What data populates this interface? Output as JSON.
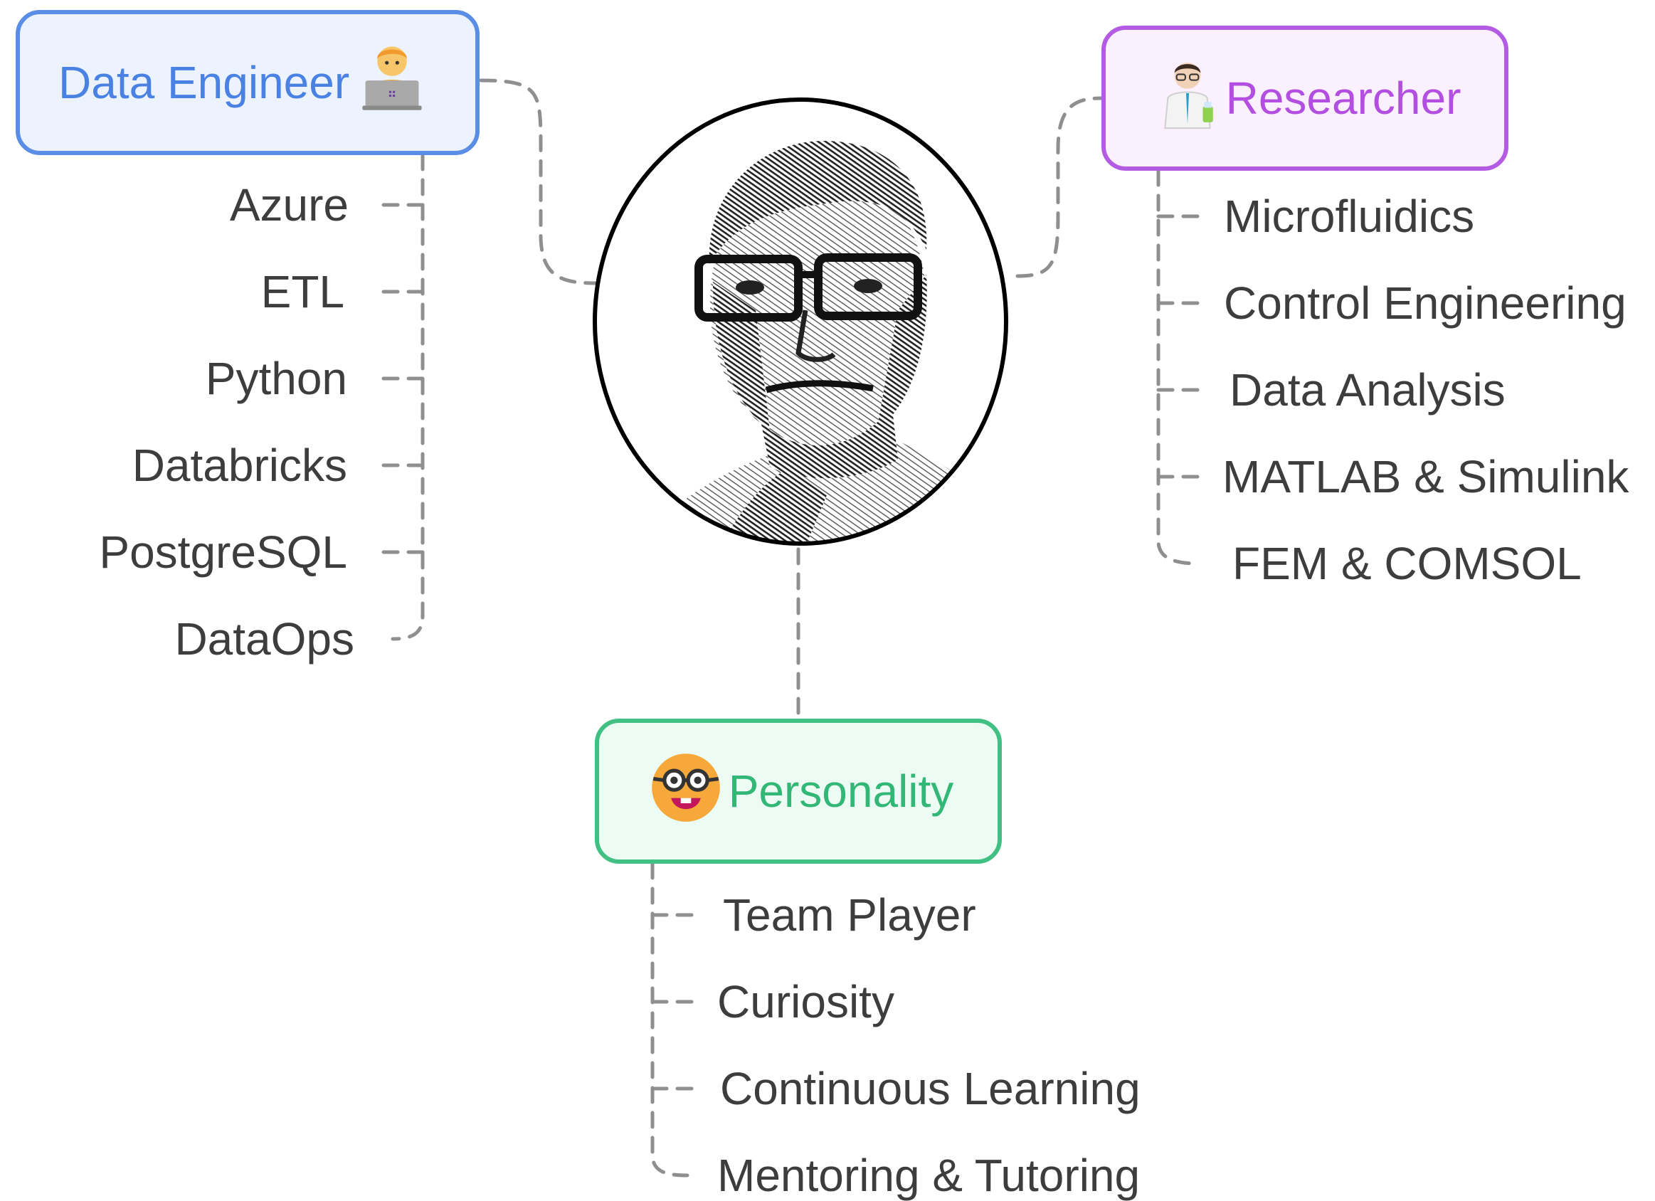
{
  "center": {
    "image": "portrait-photo"
  },
  "data_engineer": {
    "label": "Data Engineer",
    "icon": "technologist-icon",
    "color": "#4a82e3",
    "items": [
      "Azure",
      "ETL",
      "Python",
      "Databricks",
      "PostgreSQL",
      "DataOps"
    ]
  },
  "researcher": {
    "label": "Researcher",
    "icon": "scientist-icon",
    "color": "#b24fe0",
    "items": [
      "Microfluidics",
      "Control Engineering",
      "Data Analysis",
      "MATLAB & Simulink",
      "FEM & COMSOL"
    ]
  },
  "personality": {
    "label": "Personality",
    "icon": "nerd-face-icon",
    "color": "#33b777",
    "items": [
      "Team Player",
      "Curiosity",
      "Continuous Learning",
      "Mentoring & Tutoring"
    ]
  }
}
